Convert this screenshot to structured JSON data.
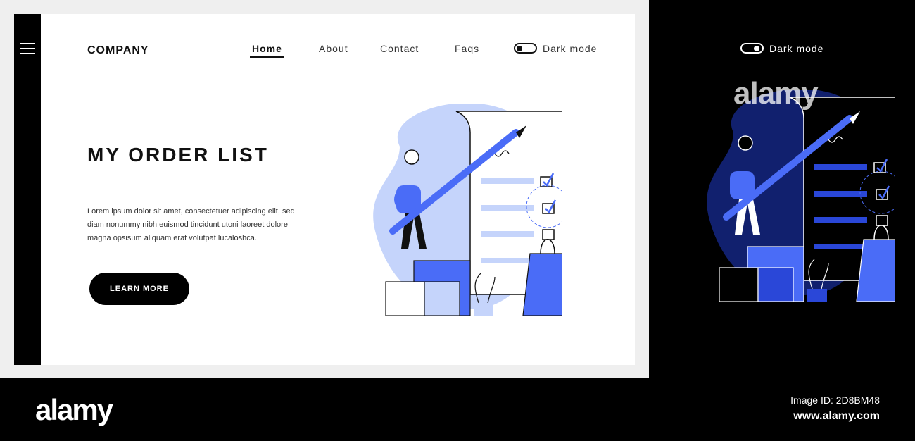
{
  "brand": "COMPANY",
  "nav": {
    "items": [
      {
        "label": "Home",
        "active": true
      },
      {
        "label": "About",
        "active": false
      },
      {
        "label": "Contact",
        "active": false
      },
      {
        "label": "Faqs",
        "active": false
      }
    ]
  },
  "dark_mode": {
    "label": "Dark mode",
    "enabled": false
  },
  "hero": {
    "title": "MY ORDER LIST",
    "body": "Lorem ipsum dolor sit amet, consectetuer adipiscing elit, sed diam nonummy nibh euismod tincidunt utoni laoreet dolore magna opsisum aliquam erat volutpat lucaloshca.",
    "cta_label": "LEARN MORE"
  },
  "dark_preview": {
    "toggle_label": "Dark mode",
    "enabled": true
  },
  "watermark": {
    "brand": "alamy",
    "image_id": "Image ID: 2D8BM48",
    "url": "www.alamy.com"
  },
  "colors": {
    "accent": "#4a6cf7",
    "accent_light": "#c5d4fb",
    "dark_navy": "#11206e",
    "ink": "#111111"
  }
}
